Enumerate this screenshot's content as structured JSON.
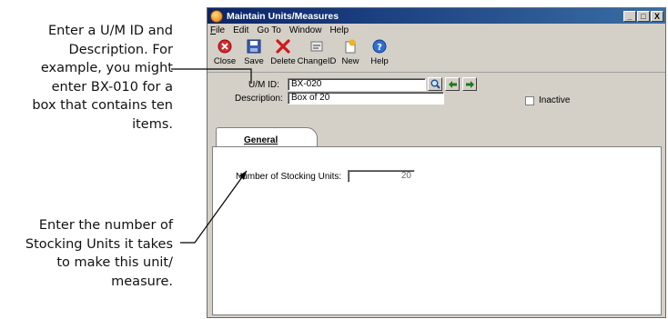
{
  "callouts": {
    "top": "Enter a U/M ID and\nDescription. For\nexample, you might\nenter BX-010 for a\nbox that contains ten\nitems.",
    "bottom": "Enter the number of\nStocking Units it takes\nto make this unit/\nmeasure."
  },
  "window": {
    "title": "Maintain Units/Measures",
    "controls": [
      "_",
      "□",
      "X"
    ]
  },
  "menu": [
    "File",
    "Edit",
    "Go To",
    "Window",
    "Help"
  ],
  "toolbar": [
    {
      "label": "Close",
      "icon": "close-icon"
    },
    {
      "label": "Save",
      "icon": "save-icon"
    },
    {
      "label": "Delete",
      "icon": "delete-icon"
    },
    {
      "label": "ChangeID",
      "icon": "change-id-icon"
    },
    {
      "label": "New",
      "icon": "new-icon"
    },
    {
      "label": "Help",
      "icon": "help-icon"
    }
  ],
  "form": {
    "um_id_label": "U/M ID:",
    "um_id_value": "BX-020",
    "description_label": "Description:",
    "description_value": "Box of 20",
    "inactive_label": "Inactive",
    "inactive_checked": false
  },
  "tabs": [
    "General"
  ],
  "general": {
    "stocking_units_label": "Number of Stocking Units:",
    "stocking_units_value": "20"
  }
}
